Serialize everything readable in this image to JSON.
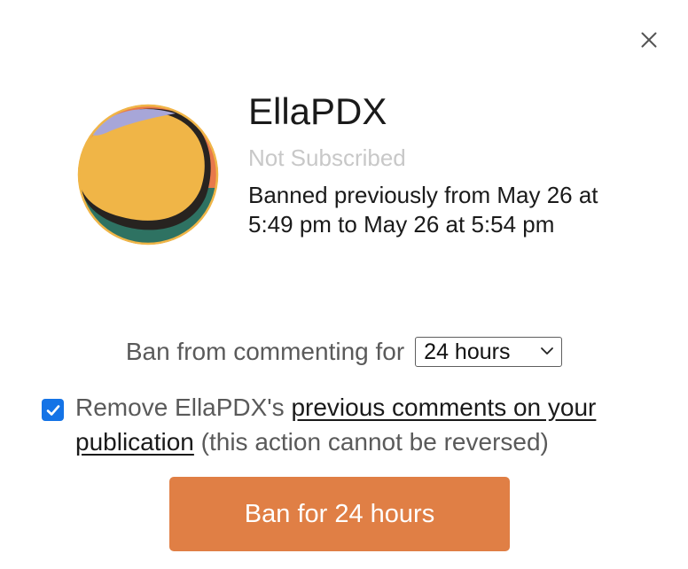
{
  "dialog": {
    "close_icon": "close-icon"
  },
  "user": {
    "name": "EllaPDX",
    "subscription_status": "Not Subscribed",
    "ban_history": "Banned previously from May 26 at 5:49 pm to May 26 at 5:54 pm",
    "avatar_colors": {
      "yellow": "#f0b547",
      "orange": "#e8794a",
      "green": "#2e7262",
      "lavender": "#a7a6d8",
      "dark": "#272320"
    }
  },
  "ban_form": {
    "duration_label": "Ban from commenting for",
    "duration_selected": "24 hours",
    "remove_checked": true,
    "remove_prefix": "Remove EllaPDX's",
    "remove_link": "previous comments on your publication",
    "remove_suffix": "(this action cannot be reversed)",
    "submit_label": "Ban for 24 hours",
    "accent_color": "#e07f45",
    "checkbox_color": "#1473e6"
  }
}
